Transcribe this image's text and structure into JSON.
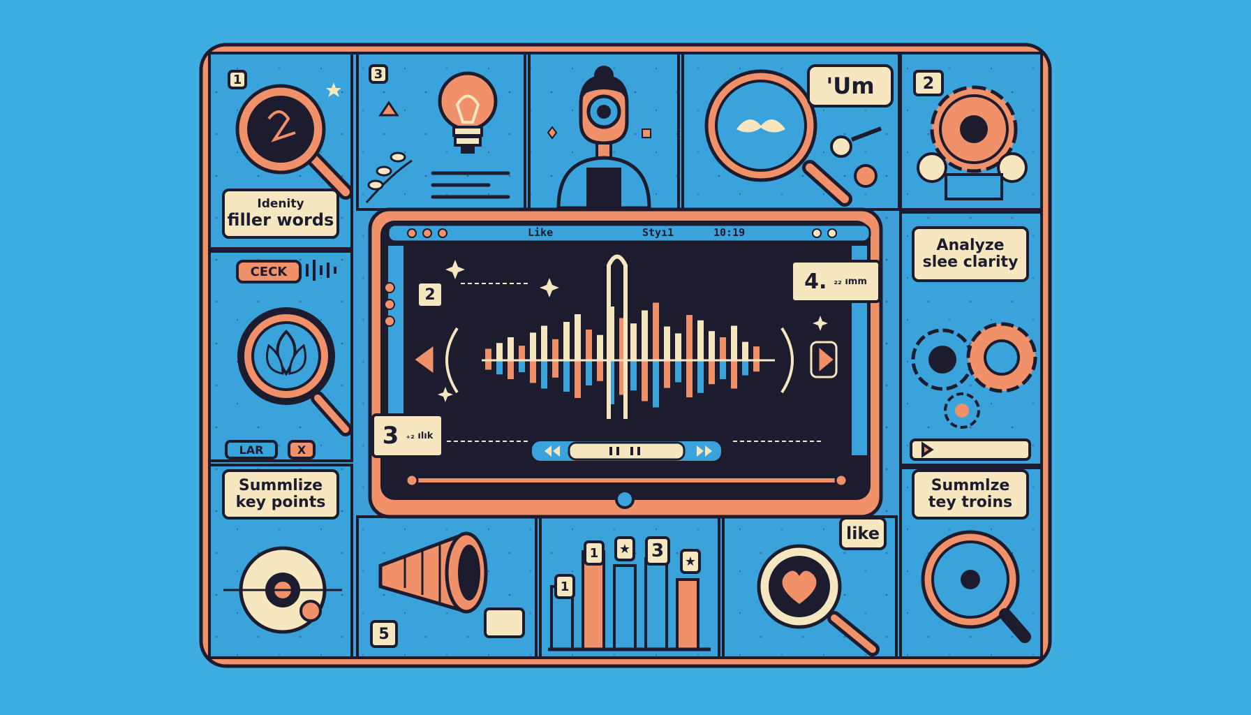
{
  "labels": {
    "identify_line1": "Idenity",
    "identify_line2": "filler words",
    "analyze_line1": "Analyze",
    "analyze_line2": "slee clarity",
    "summarize_left_line1": "Summlize",
    "summarize_left_line2": "key points",
    "summarize_right_line1": "Summlze",
    "summarize_right_line2": "tey troins"
  },
  "badges": {
    "p1": "1",
    "p2": "2",
    "p3": "3",
    "p5": "5",
    "m2": "2",
    "m3": "3",
    "m3_note": "₊₂ ılık",
    "m4": "4.",
    "m4_note": "₂₂ ımm"
  },
  "speech": {
    "um": "'Um",
    "like": "like"
  },
  "buttons": {
    "check": "CECK",
    "lar": "LAR",
    "x": "X"
  },
  "monitor": {
    "title_like": "Like",
    "title_style": "Styı1",
    "title_time": "10:19"
  },
  "chart_badges": {
    "b1": "1",
    "b1s": "1",
    "bstar": "★",
    "b3": "3",
    "bstar2": "★"
  },
  "colors": {
    "background": "#3eaee0",
    "panel": "#3f9fd8",
    "outline": "#1d1b2e",
    "cream": "#f6e7c1",
    "orange": "#f0916a",
    "blue": "#3aa3dc",
    "dark": "#1d1b2e"
  },
  "icons": [
    "magnifier-icon",
    "lightbulb-icon",
    "person-icon",
    "gear-icon",
    "leaf-icon",
    "megaphone-icon",
    "heart-icon",
    "target-icon",
    "waveform-icon"
  ]
}
